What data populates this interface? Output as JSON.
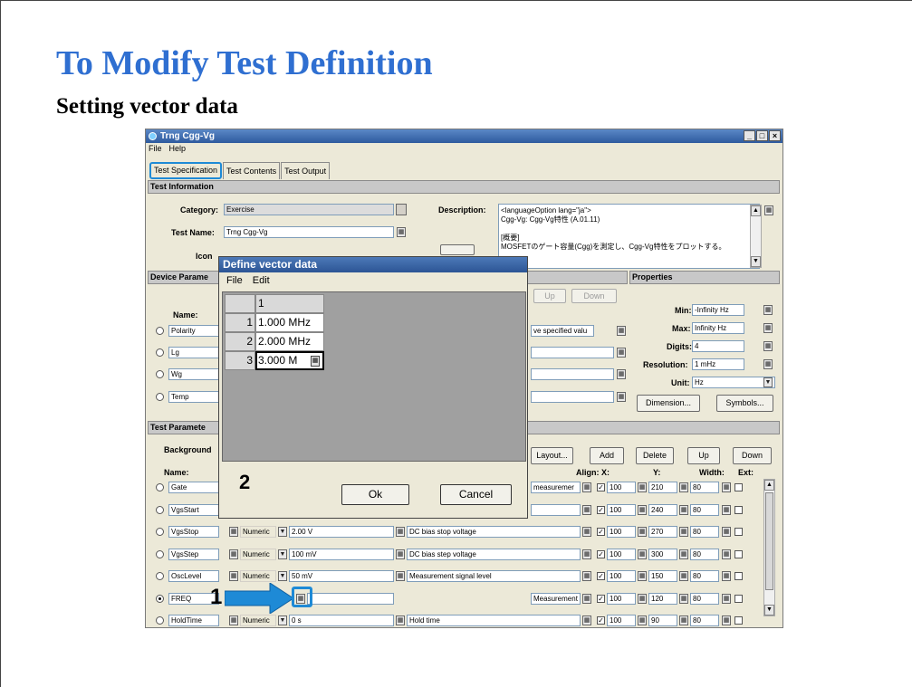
{
  "slide": {
    "title": "To Modify Test Definition",
    "subtitle": "Setting vector data",
    "callout_1": "1",
    "callout_2": "2"
  },
  "window": {
    "title": "Trng Cgg-Vg",
    "menu": [
      "File",
      "Help"
    ],
    "tabs": [
      "Test Specification",
      "Test Contents",
      "Test Output"
    ],
    "test_info": {
      "header": "Test Information",
      "category_label": "Category:",
      "category_value": "Exercise",
      "test_name_label": "Test Name:",
      "test_name_value": "Trng Cgg-Vg",
      "icon_label": "Icon",
      "description_label": "Description:",
      "description_lines": [
        "<languageOption lang=\"ja\">",
        "Cgg-Vg: Cgg-Vg特性 (A.01.11)",
        "",
        "[概要]",
        " MOSFETのゲート容量(Cgg)を測定し、Cgg-Vg特性をプロットする。"
      ]
    },
    "device_params": {
      "header": "Device Parame",
      "name_label": "Name:",
      "up": "Up",
      "down": "Down",
      "rows": [
        {
          "name": "Polarity",
          "extra": "ve specified valu"
        },
        {
          "name": "Lg",
          "extra": ""
        },
        {
          "name": "Wg",
          "extra": ""
        },
        {
          "name": "Temp",
          "extra": ""
        }
      ]
    },
    "properties": {
      "header": "Properties",
      "min_label": "Min:",
      "min_value": "-Infinity Hz",
      "max_label": "Max:",
      "max_value": "Infinity Hz",
      "digits_label": "Digits:",
      "digits_value": "4",
      "resolution_label": "Resolution:",
      "resolution_value": "1 mHz",
      "unit_label": "Unit:",
      "unit_value": "Hz",
      "dimension_button": "Dimension...",
      "symbols_button": "Symbols..."
    },
    "test_params": {
      "header": "Test Paramete",
      "background_label": "Background",
      "name_label": "Name:",
      "layout_button": "Layout...",
      "add_button": "Add",
      "delete_button": "Delete",
      "up_button": "Up",
      "down_button": "Down",
      "align_label": "Align: X:",
      "y_label": "Y:",
      "width_label": "Width:",
      "ext_label": "Ext:",
      "rows": [
        {
          "name": "Gate",
          "type": "",
          "value": "",
          "desc": "measuremer",
          "x": "100",
          "y": "210",
          "w": "80",
          "selected": false
        },
        {
          "name": "VgsStart",
          "type": "",
          "value": "",
          "desc": "",
          "x": "100",
          "y": "240",
          "w": "80",
          "selected": false
        },
        {
          "name": "VgsStop",
          "type": "Numeric",
          "value": "2.00 V",
          "desc": "DC bias stop voltage",
          "x": "100",
          "y": "270",
          "w": "80",
          "selected": false
        },
        {
          "name": "VgsStep",
          "type": "Numeric",
          "value": "100 mV",
          "desc": "DC bias step voltage",
          "x": "100",
          "y": "300",
          "w": "80",
          "selected": false
        },
        {
          "name": "OscLevel",
          "type": "Numeric",
          "value": "50 mV",
          "desc": "Measurement signal level",
          "x": "100",
          "y": "150",
          "w": "80",
          "selected": false
        },
        {
          "name": "FREQ",
          "type": "",
          "value": "",
          "desc": "Measurement frequency",
          "x": "100",
          "y": "120",
          "w": "80",
          "selected": true
        },
        {
          "name": "HoldTime",
          "type": "Numeric",
          "value": "0 s",
          "desc": "Hold time",
          "x": "100",
          "y": "90",
          "w": "80",
          "selected": false
        }
      ]
    }
  },
  "dialog": {
    "title": "Define vector data",
    "menu": [
      "File",
      "Edit"
    ],
    "column_header": "1",
    "rows": [
      {
        "index": "1",
        "value": "1.000 MHz"
      },
      {
        "index": "2",
        "value": "2.000 MHz"
      },
      {
        "index": "3",
        "value": "3.000 M"
      }
    ],
    "ok_button": "Ok",
    "cancel_button": "Cancel"
  },
  "colors": {
    "title_blue": "#2f6fd1",
    "highlight_blue": "#1e8ad6",
    "window_bg": "#ece9d8"
  }
}
